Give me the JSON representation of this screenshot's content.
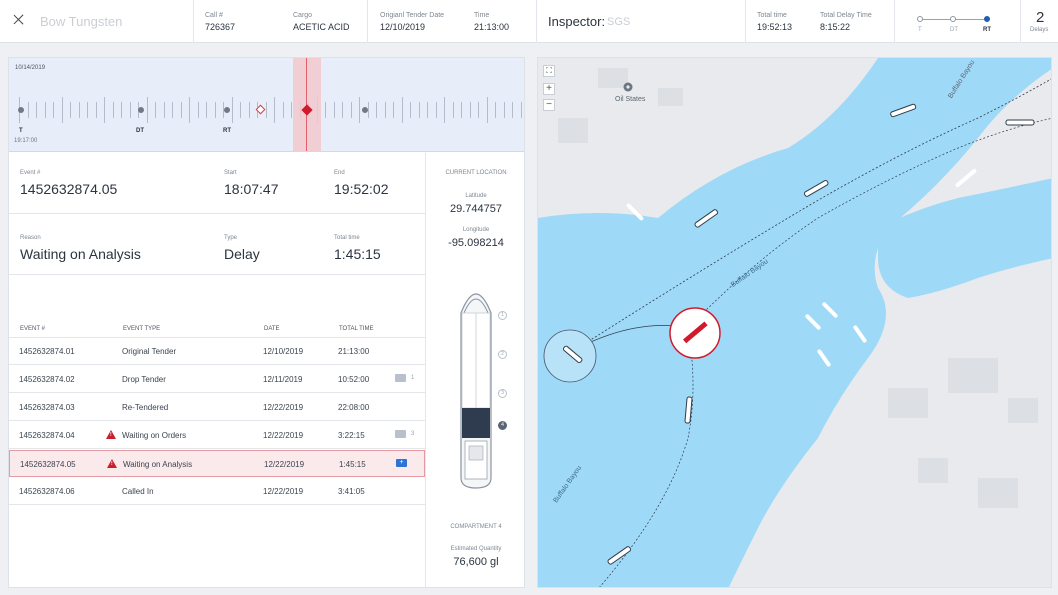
{
  "header": {
    "close_icon": "close-icon",
    "vessel_name": "Bow Tungsten",
    "call_label": "Call #",
    "call_value": "726367",
    "cargo_label": "Cargo",
    "cargo_value": "ACETIC ACID",
    "tender_label": "Origianl Tender Date",
    "tender_value": "12/10/2019",
    "time_label": "Time",
    "time_value": "21:13:00",
    "inspector_label": "Inspector:",
    "inspector_value": "SGS",
    "total_time_label": "Total time",
    "total_time_value": "19:52:13",
    "total_delay_label": "Total Delay Time",
    "total_delay_value": "8:15:22",
    "progress_steps": [
      "T",
      "DT",
      "RT"
    ],
    "progress_active": "RT",
    "delays_count": "2",
    "delays_label": "Delays"
  },
  "timeline": {
    "date": "10/14/2019",
    "markers": [
      {
        "label": "T",
        "sub": "19:17:00"
      },
      {
        "label": "DT",
        "sub": ""
      },
      {
        "label": "RT",
        "sub": ""
      }
    ]
  },
  "event": {
    "event_label": "Event #",
    "event_value": "1452632874.05",
    "start_label": "Start",
    "start_value": "18:07:47",
    "end_label": "End",
    "end_value": "19:52:02",
    "reason_label": "Reason",
    "reason_value": "Waiting on Analysis",
    "type_label": "Type",
    "type_value": "Delay",
    "total_label": "Total time",
    "total_value": "1:45:15"
  },
  "location": {
    "title": "CURRENT LOCATION",
    "lat_label": "Latitude",
    "lat_value": "29.744757",
    "lon_label": "Longitude",
    "lon_value": "-95.098214",
    "compartments": [
      "1",
      "2",
      "3",
      "4"
    ],
    "active_compartment": "4",
    "compartment_label": "COMPARTMENT 4",
    "qty_label": "Estimated Quantity",
    "qty_value": "76,600 gl"
  },
  "table": {
    "headers": [
      "EVENT #",
      "EVENT TYPE",
      "DATE",
      "TOTAL TIME"
    ],
    "rows": [
      {
        "event": "1452632874.01",
        "type": "Original Tender",
        "date": "12/10/2019",
        "total": "21:13:00",
        "warning": false,
        "comments": ""
      },
      {
        "event": "1452632874.02",
        "type": "Drop Tender",
        "date": "12/11/2019",
        "total": "10:52:00",
        "warning": false,
        "comments": "1"
      },
      {
        "event": "1452632874.03",
        "type": "Re-Tendered",
        "date": "12/22/2019",
        "total": "22:08:00",
        "warning": false,
        "comments": ""
      },
      {
        "event": "1452632874.04",
        "type": "Waiting on Orders",
        "date": "12/22/2019",
        "total": "3:22:15",
        "warning": true,
        "comments": "3"
      },
      {
        "event": "1452632874.05",
        "type": "Waiting on Analysis",
        "date": "12/22/2019",
        "total": "1:45:15",
        "warning": true,
        "comments": "+",
        "selected": true
      },
      {
        "event": "1452632874.06",
        "type": "Called In",
        "date": "12/22/2019",
        "total": "3:41:05",
        "warning": false,
        "comments": ""
      }
    ]
  },
  "map": {
    "labels": [
      "Oil States",
      "Buffalo Bayou",
      "Buffalo Bayou",
      "Buffalo Bayou"
    ],
    "controls": [
      "fullscreen-icon",
      "+",
      "−"
    ],
    "water_color": "#9fd9f8",
    "land_color": "#e8eaed",
    "vessel_color": "#d11b2c"
  },
  "colors": {
    "accent": "#1f5fae",
    "alert": "#c8202e",
    "selected_row": "#fbeaec"
  }
}
